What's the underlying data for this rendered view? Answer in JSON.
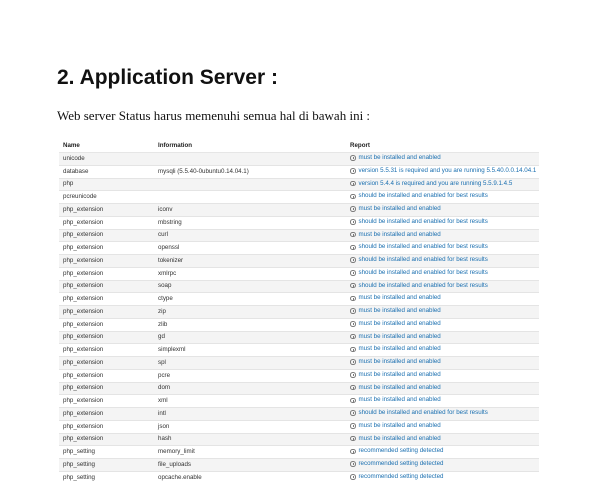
{
  "heading": "2. Application Server :",
  "intro": "Web server Status harus memenuhi semua hal di bawah ini :",
  "table": {
    "columns": [
      "Name",
      "Information",
      "Report"
    ],
    "rows": [
      {
        "name": "unicode",
        "info": "",
        "report": "must be installed and enabled"
      },
      {
        "name": "database",
        "info": "mysqli (5.5.40-0ubuntu0.14.04.1)",
        "report": "version 5.5.31 is required and you are running 5.5.40.0.0.14.04.1"
      },
      {
        "name": "php",
        "info": "",
        "report": "version 5.4.4 is required and you are running 5.5.9.1.4.5"
      },
      {
        "name": "pcreunicode",
        "info": "",
        "report": "should be installed and enabled for best results"
      },
      {
        "name": "php_extension",
        "info": "iconv",
        "report": "must be installed and enabled"
      },
      {
        "name": "php_extension",
        "info": "mbstring",
        "report": "should be installed and enabled for best results"
      },
      {
        "name": "php_extension",
        "info": "curl",
        "report": "must be installed and enabled"
      },
      {
        "name": "php_extension",
        "info": "openssl",
        "report": "should be installed and enabled for best results"
      },
      {
        "name": "php_extension",
        "info": "tokenizer",
        "report": "should be installed and enabled for best results"
      },
      {
        "name": "php_extension",
        "info": "xmlrpc",
        "report": "should be installed and enabled for best results"
      },
      {
        "name": "php_extension",
        "info": "soap",
        "report": "should be installed and enabled for best results"
      },
      {
        "name": "php_extension",
        "info": "ctype",
        "report": "must be installed and enabled"
      },
      {
        "name": "php_extension",
        "info": "zip",
        "report": "must be installed and enabled"
      },
      {
        "name": "php_extension",
        "info": "zlib",
        "report": "must be installed and enabled"
      },
      {
        "name": "php_extension",
        "info": "gd",
        "report": "must be installed and enabled"
      },
      {
        "name": "php_extension",
        "info": "simplexml",
        "report": "must be installed and enabled"
      },
      {
        "name": "php_extension",
        "info": "spl",
        "report": "must be installed and enabled"
      },
      {
        "name": "php_extension",
        "info": "pcre",
        "report": "must be installed and enabled"
      },
      {
        "name": "php_extension",
        "info": "dom",
        "report": "must be installed and enabled"
      },
      {
        "name": "php_extension",
        "info": "xml",
        "report": "must be installed and enabled"
      },
      {
        "name": "php_extension",
        "info": "intl",
        "report": "should be installed and enabled for best results"
      },
      {
        "name": "php_extension",
        "info": "json",
        "report": "must be installed and enabled"
      },
      {
        "name": "php_extension",
        "info": "hash",
        "report": "must be installed and enabled"
      },
      {
        "name": "php_setting",
        "info": "memory_limit",
        "report": "recommended setting detected"
      },
      {
        "name": "php_setting",
        "info": "file_uploads",
        "report": "recommended setting detected"
      },
      {
        "name": "php_setting",
        "info": "opcache.enable",
        "report": "recommended setting detected"
      }
    ]
  },
  "colors": {
    "report_text": "#1a6fb0",
    "row_stripe": "#f4f4f4"
  },
  "icons": {
    "report_icon": "info-circle-icon"
  }
}
